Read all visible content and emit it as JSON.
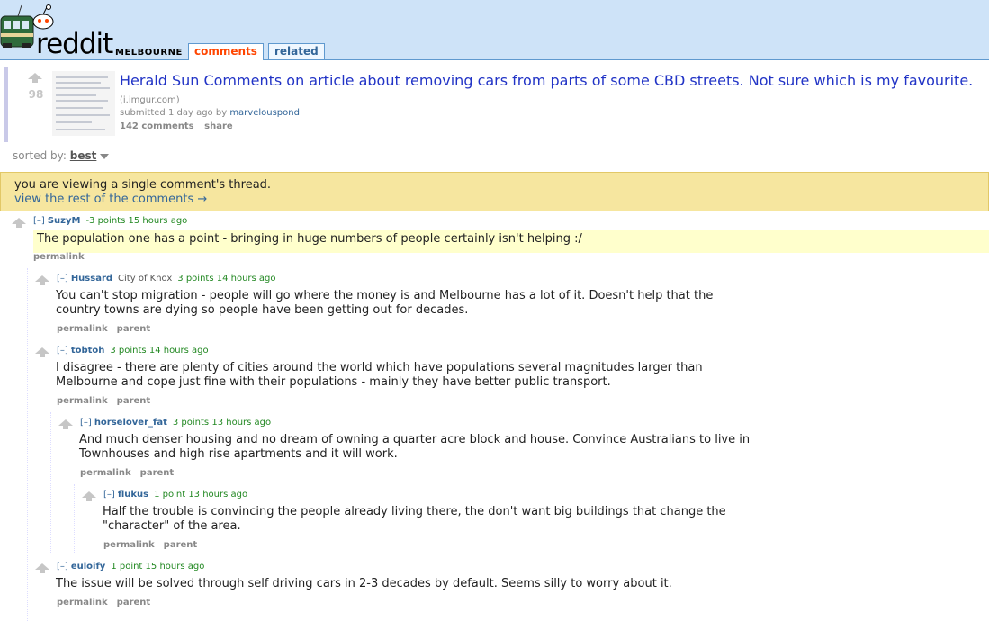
{
  "header": {
    "logo_text": "reddit",
    "subreddit": "MELBOURNE",
    "tabs": [
      {
        "label": "comments",
        "selected": true
      },
      {
        "label": "related",
        "selected": false
      }
    ]
  },
  "post": {
    "score": "98",
    "title": "Herald Sun Comments on article about removing cars from parts of some CBD streets. Not sure which is my favourite.",
    "domain": "(i.imgur.com)",
    "submitted_prefix": "submitted",
    "submitted_time": "1 day ago",
    "by": "by",
    "author": "marvelouspond",
    "comments_label": "142 comments",
    "share_label": "share"
  },
  "sort": {
    "label": "sorted by:",
    "value": "best"
  },
  "infobar": {
    "text": "you are viewing a single comment's thread.",
    "link": "view the rest of the comments →"
  },
  "comments": [
    {
      "expand": "[–]",
      "author": "SuzyM",
      "flair": "",
      "score": "-3 points",
      "time": "15 hours ago",
      "lines": [
        "The population one has a point - bringing in huge numbers of people certainly isn't helping :/"
      ],
      "buttons": [
        "permalink"
      ]
    },
    {
      "expand": "[–]",
      "author": "Hussard",
      "flair": "City of Knox",
      "score": "3 points",
      "time": "14 hours ago",
      "lines": [
        "You can't stop migration - people will go where the money is and Melbourne has a lot of it. Doesn't help that the",
        "country towns are dying so people have been getting out for decades."
      ],
      "buttons": [
        "permalink",
        "parent"
      ]
    },
    {
      "expand": "[–]",
      "author": "tobtoh",
      "flair": "",
      "score": "3 points",
      "time": "14 hours ago",
      "lines": [
        "I disagree - there are plenty of cities around the world which have populations several magnitudes larger than",
        "Melbourne and cope just fine with their populations - mainly they have better public transport."
      ],
      "buttons": [
        "permalink",
        "parent"
      ]
    },
    {
      "expand": "[–]",
      "author": "horselover_fat",
      "flair": "",
      "score": "3 points",
      "time": "13 hours ago",
      "lines": [
        "And much denser housing and no dream of owning a quarter acre block and house. Convince Australians to live in",
        "Townhouses and high rise apartments and it will work."
      ],
      "buttons": [
        "permalink",
        "parent"
      ]
    },
    {
      "expand": "[–]",
      "author": "flukus",
      "flair": "",
      "score": "1 point",
      "time": "13 hours ago",
      "lines": [
        "Half the trouble is convincing the people already living there, the don't want big buildings that change the",
        "\"character\" of the area."
      ],
      "buttons": [
        "permalink",
        "parent"
      ]
    },
    {
      "expand": "[–]",
      "author": "euloify",
      "flair": "",
      "score": "1 point",
      "time": "15 hours ago",
      "lines": [
        "The issue will be solved through self driving cars in 2-3 decades by default. Seems silly to worry about it."
      ],
      "buttons": [
        "permalink",
        "parent"
      ]
    }
  ]
}
